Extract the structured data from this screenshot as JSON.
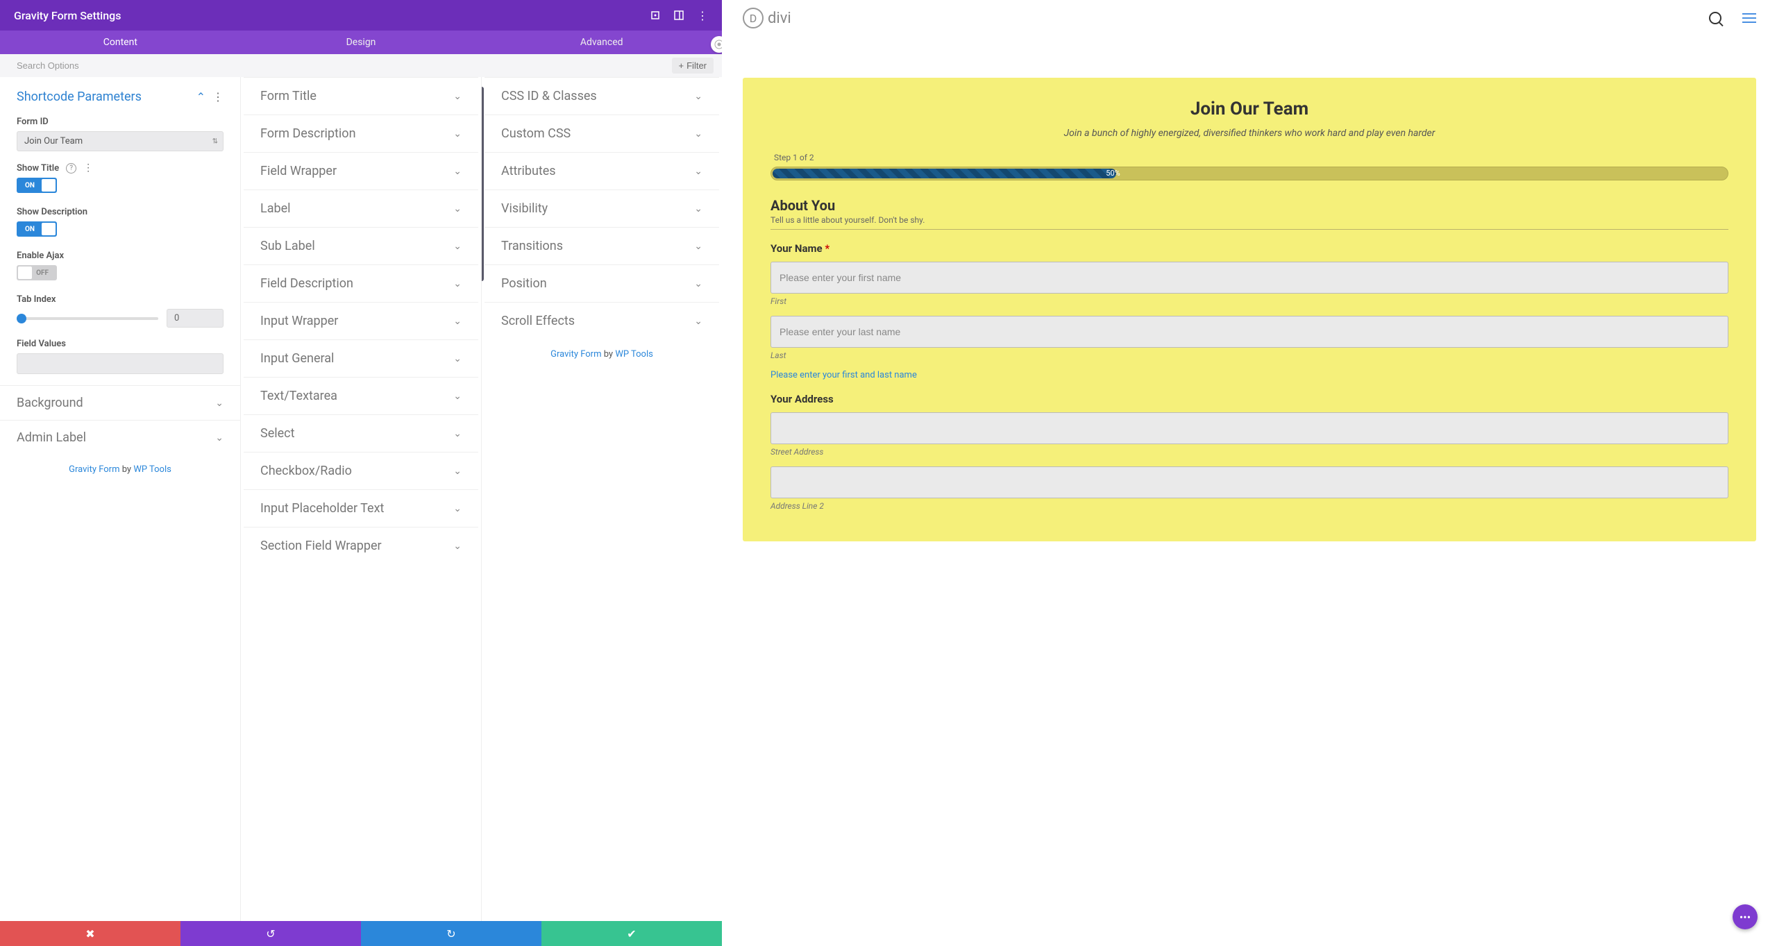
{
  "header": {
    "title": "Gravity Form Settings"
  },
  "tabs": {
    "content": "Content",
    "design": "Design",
    "advanced": "Advanced"
  },
  "search": {
    "placeholder": "Search Options",
    "filter": "Filter"
  },
  "left": {
    "shortcode_title": "Shortcode Parameters",
    "form_id_label": "Form ID",
    "form_id_value": "Join Our Team",
    "show_title_label": "Show Title",
    "show_desc_label": "Show Description",
    "enable_ajax_label": "Enable Ajax",
    "tab_index_label": "Tab Index",
    "tab_index_value": "0",
    "field_values_label": "Field Values",
    "on": "ON",
    "off": "OFF",
    "background": "Background",
    "admin_label": "Admin Label"
  },
  "credits": {
    "gravity": "Gravity Form",
    "by": " by ",
    "wptools": "WP Tools"
  },
  "mid": {
    "items": [
      "Form Title",
      "Form Description",
      "Field Wrapper",
      "Label",
      "Sub Label",
      "Field Description",
      "Input Wrapper",
      "Input General",
      "Text/Textarea",
      "Select",
      "Checkbox/Radio",
      "Input Placeholder Text",
      "Section Field Wrapper"
    ]
  },
  "right": {
    "items": [
      "CSS ID & Classes",
      "Custom CSS",
      "Attributes",
      "Visibility",
      "Transitions",
      "Position",
      "Scroll Effects"
    ]
  },
  "preview": {
    "logo": "divi",
    "form_title": "Join Our Team",
    "form_subtitle": "Join a bunch of highly energized, diversified thinkers who work hard and play even harder",
    "step": "Step 1 of 2",
    "progress": "50%",
    "section_title": "About You",
    "section_desc": "Tell us a little about yourself. Don't be shy.",
    "name_label": "Your Name",
    "first_ph": "Please enter your first name",
    "first_sub": "First",
    "last_ph": "Please enter your last name",
    "last_sub": "Last",
    "name_desc": "Please enter your first and last name",
    "address_label": "Your Address",
    "street_sub": "Street Address",
    "line2_sub": "Address Line 2"
  }
}
